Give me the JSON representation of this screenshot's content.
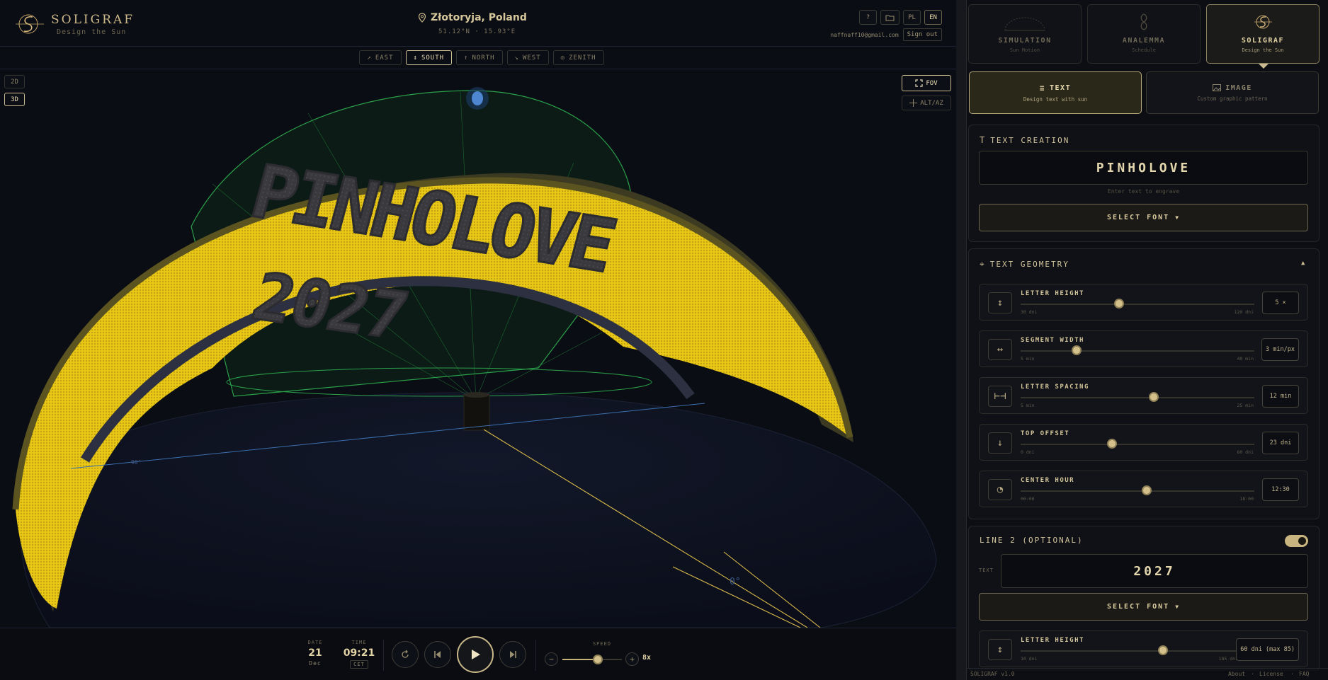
{
  "brand": {
    "name": "SOLIGRAF",
    "tagline": "Design the Sun"
  },
  "location": {
    "name": "Złotoryja, Poland",
    "coords": "51.12°N · 15.93°E"
  },
  "top_buttons": {
    "help": "?",
    "lang_pl": "PL",
    "lang_en": "EN"
  },
  "account": {
    "email": "naffnaff10@gmail.com",
    "sign_out": "Sign out"
  },
  "directions": [
    {
      "icon": "↗",
      "label": "EAST"
    },
    {
      "icon": "↕",
      "label": "SOUTH"
    },
    {
      "icon": "↑",
      "label": "NORTH"
    },
    {
      "icon": "↘",
      "label": "WEST"
    },
    {
      "icon": "◎",
      "label": "ZENITH"
    }
  ],
  "active_direction": "SOUTH",
  "view_modes": {
    "two_d": "2D",
    "three_d": "3D",
    "active": "3D"
  },
  "view_tools": {
    "fov": "FOV",
    "altaz": "ALT/AZ"
  },
  "scene": {
    "engraved_text": "PINHOLOVE",
    "engraved_line2": "2027",
    "horizon_label_left": "90°",
    "horizon_label_right": "0°",
    "colors": {
      "surface": "#f2d31b",
      "sky_dome": "#1b8f3a",
      "ground": "#111627"
    }
  },
  "playback": {
    "date_label": "DATE",
    "date_day": "21",
    "date_month": "Dec",
    "time_label": "TIME",
    "time": "09:21",
    "tz": "CET",
    "speed_label": "SPEED",
    "speed_value": "8x",
    "speed_fraction": 0.6,
    "minus": "−",
    "plus": "+"
  },
  "modes": [
    {
      "title": "SIMULATION",
      "subtitle": "Sun Motion"
    },
    {
      "title": "ANALEMMA",
      "subtitle": "Schedule"
    },
    {
      "title": "SOLIGRAF",
      "subtitle": "Design the Sun"
    }
  ],
  "active_mode": "SOLIGRAF",
  "submodes": [
    {
      "title": "TEXT",
      "subtitle": "Design text with sun"
    },
    {
      "title": "IMAGE",
      "subtitle": "Custom graphic pattern"
    }
  ],
  "text_creation": {
    "title": "TEXT CREATION",
    "value": "PINHOLOVE",
    "hint": "Enter text to engrave",
    "font_button": "SELECT FONT"
  },
  "text_geometry": {
    "title": "TEXT GEOMETRY",
    "sliders": [
      {
        "label": "LETTER HEIGHT",
        "min": "30 dni",
        "max": "120 dni",
        "value": "5 ×",
        "fraction": 0.42,
        "icon": "↕"
      },
      {
        "label": "SEGMENT WIDTH",
        "min": "5 min",
        "max": "40 min",
        "value": "3 min/px",
        "fraction": 0.24,
        "icon": "↔"
      },
      {
        "label": "LETTER SPACING",
        "min": "5 min",
        "max": "25 min",
        "value": "12 min",
        "fraction": 0.57,
        "icon": "⊢⊣"
      },
      {
        "label": "TOP OFFSET",
        "min": "0 dni",
        "max": "60 dni",
        "value": "23 dni",
        "fraction": 0.39,
        "icon": "↓"
      },
      {
        "label": "CENTER HOUR",
        "min": "06:00",
        "max": "18:00",
        "value": "12:30",
        "fraction": 0.54,
        "icon": "◔"
      }
    ]
  },
  "line2": {
    "title": "LINE 2 (OPTIONAL)",
    "enabled": true,
    "text_label": "TEXT",
    "value": "2027",
    "font_button": "SELECT FONT",
    "slider": {
      "label": "LETTER HEIGHT",
      "min": "10 dni",
      "max": "185 dni",
      "value": "60 dni (max 85)",
      "fraction": 0.66,
      "icon": "↕"
    }
  },
  "footer": {
    "version": "SOLIGRAF v1.0",
    "links": [
      "About",
      "License",
      "FAQ"
    ]
  }
}
